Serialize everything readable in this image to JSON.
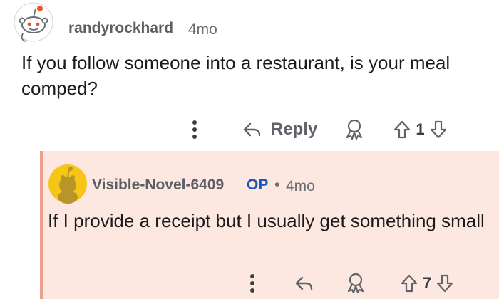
{
  "comments": [
    {
      "username": "randyrockhard",
      "time": "4mo",
      "body": "If you follow someone into a restaurant, is your meal comped?",
      "reply_label": "Reply",
      "score": "1",
      "avatar": "snoo-avatar"
    },
    {
      "username": "Visible-Novel-6409",
      "op_badge": "OP",
      "separator": "•",
      "time": "4mo",
      "body": "If I provide a receipt but I usually get something small",
      "score": "7",
      "avatar": "yellow-snoo-avatar"
    }
  ],
  "colors": {
    "reply_highlight_bg": "#fde8e1",
    "reply_highlight_border": "#e9a18d",
    "op_badge": "#1a58b8",
    "meta_text": "#5b5f63"
  },
  "icons": [
    "more-options-icon",
    "reply-arrow-icon",
    "award-icon",
    "upvote-arrow-icon",
    "downvote-arrow-icon"
  ]
}
